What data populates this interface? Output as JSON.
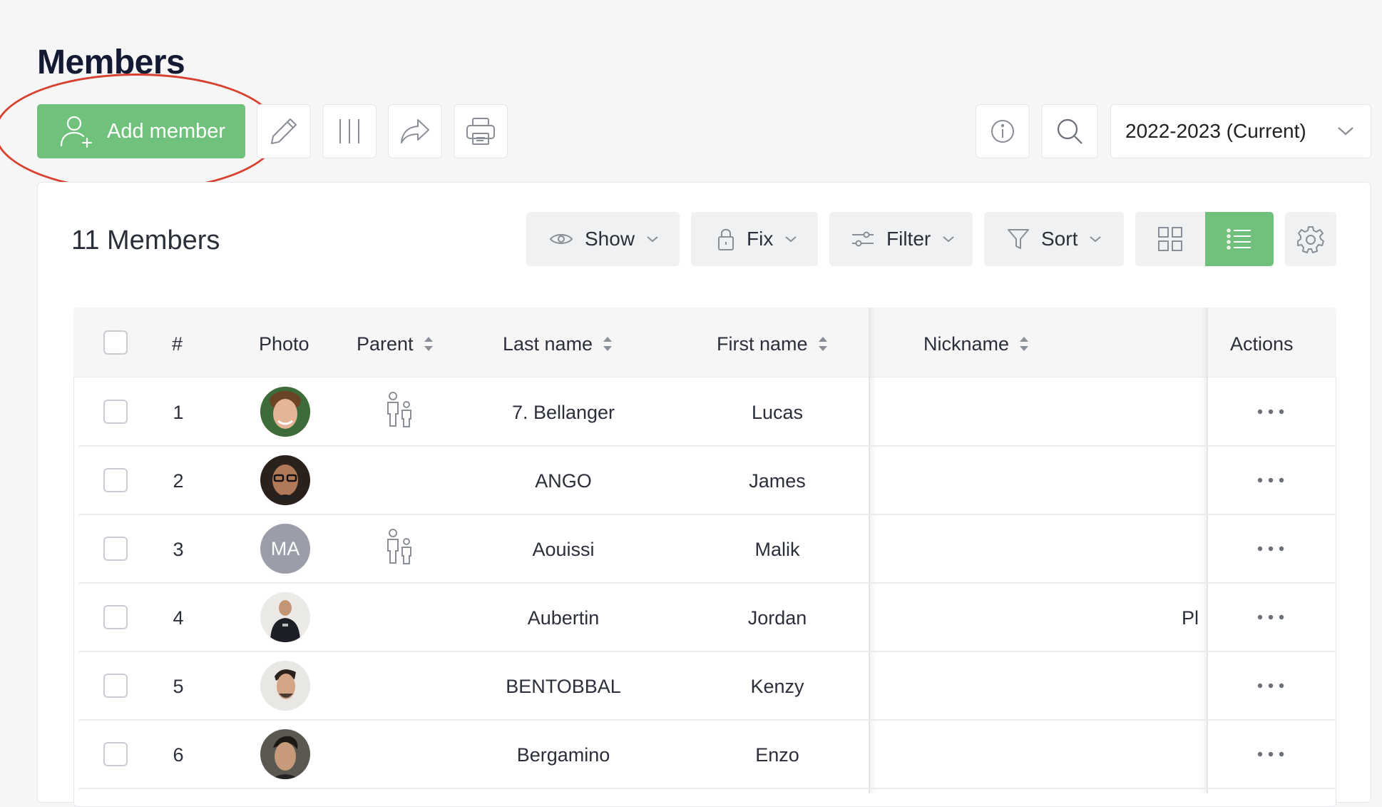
{
  "page": {
    "title": "Members"
  },
  "toolbar": {
    "add_member_label": "Add member",
    "season_label": "2022-2023 (Current)"
  },
  "panel": {
    "count_label": "11 Members",
    "show_label": "Show",
    "fix_label": "Fix",
    "filter_label": "Filter",
    "sort_label": "Sort",
    "active_view": "list"
  },
  "colors": {
    "accent": "#6fc17b",
    "annotation": "#d8402f"
  },
  "table": {
    "columns": {
      "number": "#",
      "photo": "Photo",
      "parent": "Parent",
      "last_name": "Last name",
      "first_name": "First name",
      "nickname": "Nickname",
      "actions": "Actions"
    },
    "rows": [
      {
        "num": "1",
        "last": "7. Bellanger",
        "first": "Lucas",
        "nickname": "",
        "parent": true,
        "photo": "photo",
        "initials": ""
      },
      {
        "num": "2",
        "last": "ANGO",
        "first": "James",
        "nickname": "",
        "parent": false,
        "photo": "photo",
        "initials": ""
      },
      {
        "num": "3",
        "last": "Aouissi",
        "first": "Malik",
        "nickname": "",
        "parent": true,
        "photo": "initials",
        "initials": "MA"
      },
      {
        "num": "4",
        "last": "Aubertin",
        "first": "Jordan",
        "nickname": "Pla",
        "parent": false,
        "photo": "photo",
        "initials": ""
      },
      {
        "num": "5",
        "last": "BENTOBBAL",
        "first": "Kenzy",
        "nickname": "",
        "parent": false,
        "photo": "photo",
        "initials": ""
      },
      {
        "num": "6",
        "last": "Bergamino",
        "first": "Enzo",
        "nickname": "",
        "parent": false,
        "photo": "photo",
        "initials": ""
      }
    ]
  }
}
